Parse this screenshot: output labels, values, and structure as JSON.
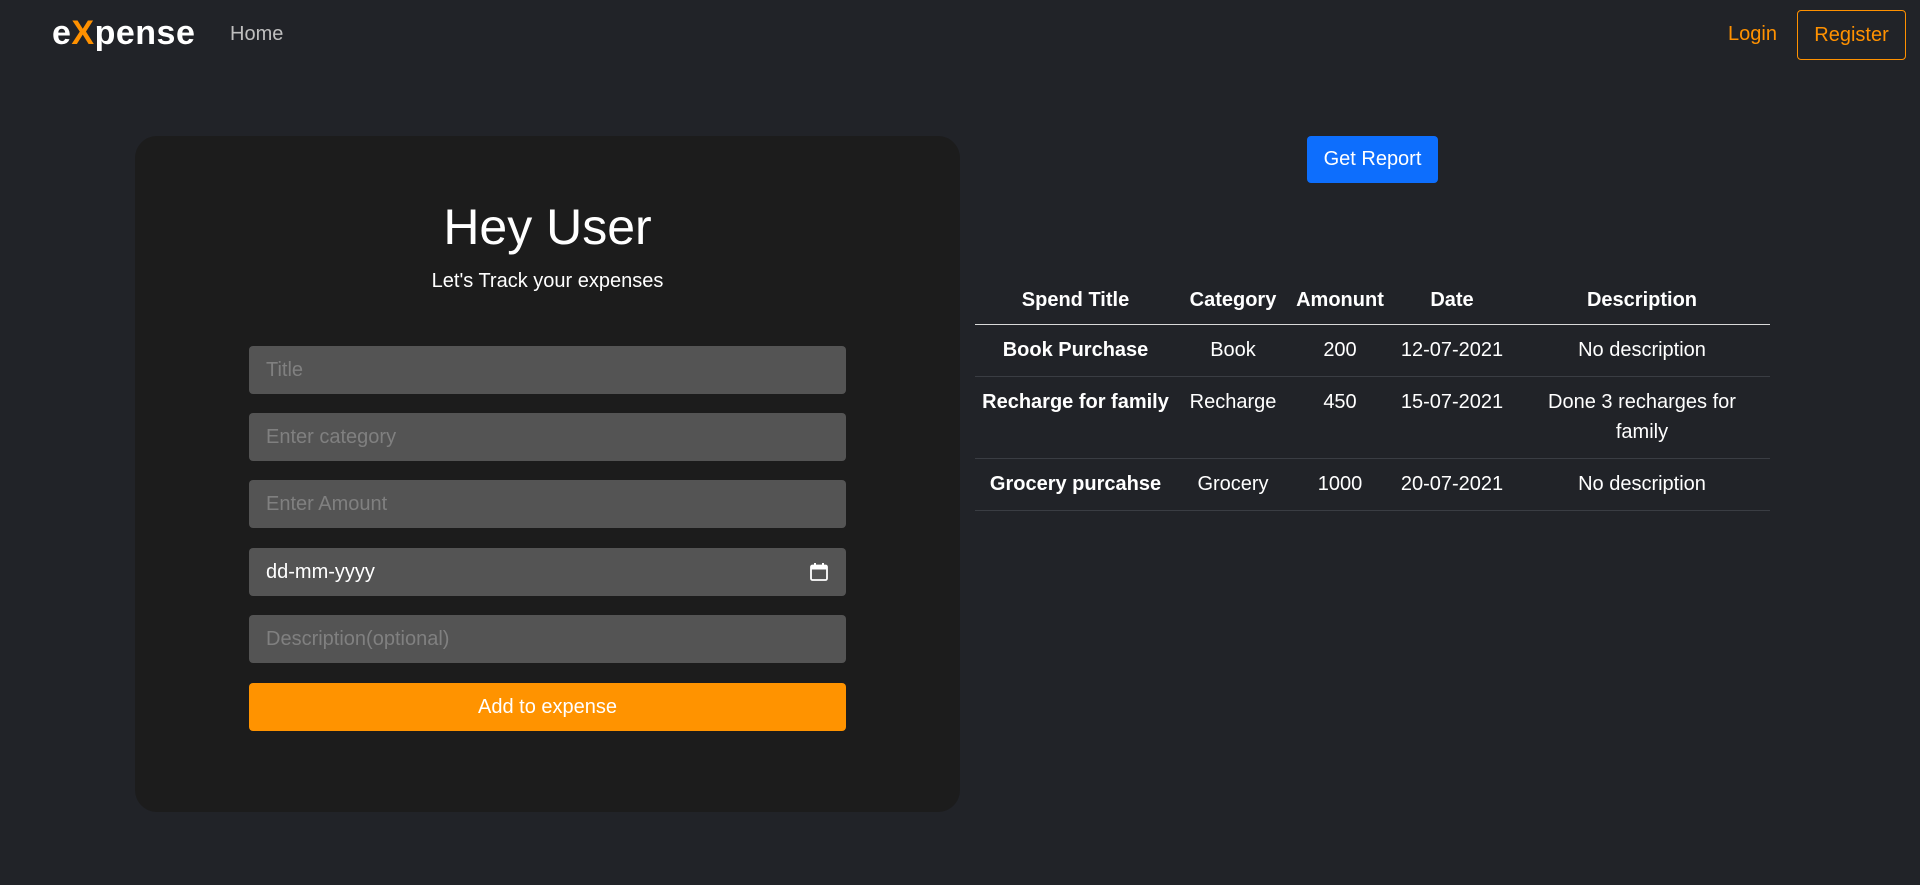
{
  "nav": {
    "brand_prefix": "e",
    "brand_accent": "X",
    "brand_suffix": "pense",
    "home": "Home",
    "login": "Login",
    "register": "Register"
  },
  "form": {
    "title": "Hey User",
    "subtitle": "Let's Track your expenses",
    "title_placeholder": "Title",
    "category_placeholder": "Enter category",
    "amount_placeholder": "Enter Amount",
    "date_value": "dd-mm-yyyy",
    "description_placeholder": "Description(optional)",
    "submit_label": "Add to expense"
  },
  "report": {
    "button_label": "Get Report"
  },
  "table": {
    "headers": [
      "Spend Title",
      "Category",
      "Amonunt",
      "Date",
      "Description"
    ],
    "rows": [
      [
        "Book Purchase",
        "Book",
        "200",
        "12-07-2021",
        "No description"
      ],
      [
        "Recharge for family",
        "Recharge",
        "450",
        "15-07-2021",
        "Done 3 recharges for family"
      ],
      [
        "Grocery purcahse",
        "Grocery",
        "1000",
        "20-07-2021",
        "No description"
      ]
    ]
  },
  "colors": {
    "background": "#212328",
    "card": "#1c1c1c",
    "accent": "#ff9100",
    "primary": "#0d6efd",
    "input": "#545454"
  },
  "icons": {
    "date_field": "calendar-icon"
  }
}
